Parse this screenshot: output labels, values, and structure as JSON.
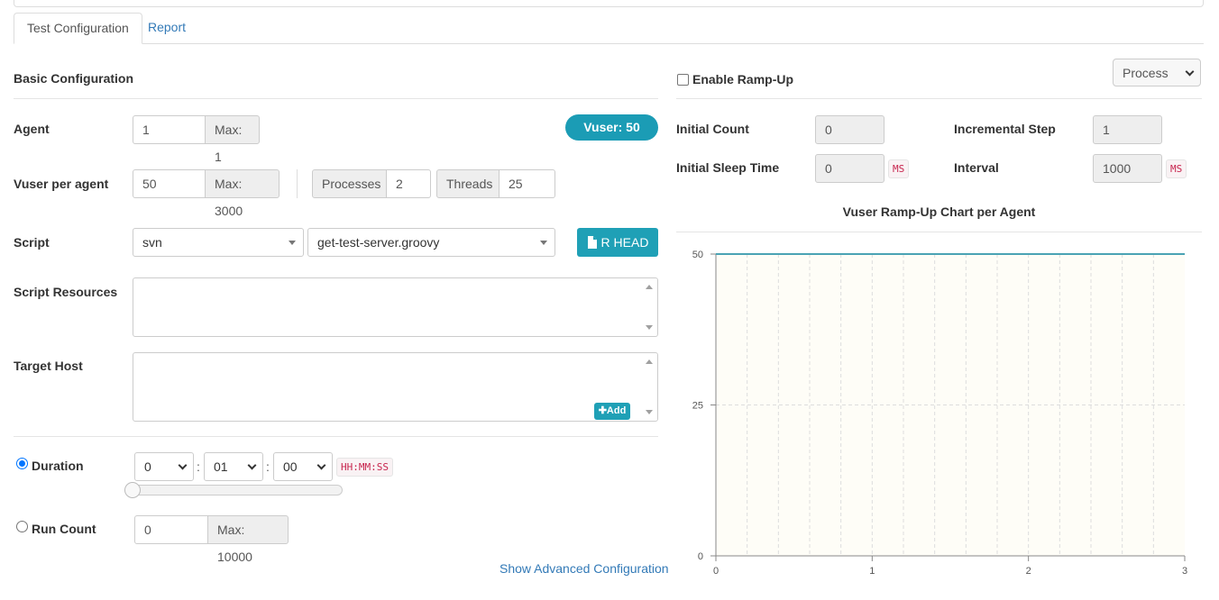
{
  "tabs": [
    {
      "label": "Test Configuration",
      "active": true
    },
    {
      "label": "Report",
      "active": false
    }
  ],
  "basic": {
    "title": "Basic Configuration",
    "agent": {
      "label": "Agent",
      "value": "1",
      "max": "Max: 1"
    },
    "vuser_badge": "Vuser: 50",
    "vuser_per_agent": {
      "label": "Vuser per agent",
      "value": "50",
      "max": "Max: 3000"
    },
    "processes": {
      "label": "Processes",
      "value": "2"
    },
    "threads": {
      "label": "Threads",
      "value": "25"
    },
    "script": {
      "label": "Script",
      "repo": "svn",
      "file": "get-test-server.groovy",
      "head_button": "R HEAD"
    },
    "script_resources": {
      "label": "Script Resources"
    },
    "target_host": {
      "label": "Target Host",
      "add_button": "Add"
    },
    "duration": {
      "label": "Duration",
      "selected": true,
      "hours": "0",
      "minutes": "01",
      "seconds": "00",
      "format": "HH:MM:SS",
      "slider_fraction": 0
    },
    "run_count": {
      "label": "Run Count",
      "selected": false,
      "value": "0",
      "max": "Max: 10000"
    },
    "advanced_link": "Show Advanced Configuration"
  },
  "rampup": {
    "enable_label": "Enable Ramp-Up",
    "enabled": false,
    "mode": "Process",
    "initial_count": {
      "label": "Initial Count",
      "value": "0"
    },
    "incremental_step": {
      "label": "Incremental Step",
      "value": "1"
    },
    "initial_sleep": {
      "label": "Initial Sleep Time",
      "value": "0",
      "unit": "MS"
    },
    "interval": {
      "label": "Interval",
      "value": "1000",
      "unit": "MS"
    },
    "chart_title": "Vuser Ramp-Up Chart per Agent"
  },
  "colors": {
    "accent": "#1b9cb5",
    "link": "#337ab7",
    "line": "#4aa3b4",
    "plot_bg": "#fefdf7"
  },
  "chart_data": {
    "type": "line",
    "title": "Vuser Ramp-Up Chart per Agent",
    "x": [
      0,
      3
    ],
    "series": [
      {
        "values": [
          50,
          50
        ]
      }
    ],
    "xlim": [
      0,
      3
    ],
    "ylim": [
      0,
      50
    ],
    "x_ticks": [
      "0",
      "1",
      "2",
      "3"
    ],
    "y_ticks": [
      "0",
      "25",
      "50"
    ],
    "grid": true
  }
}
